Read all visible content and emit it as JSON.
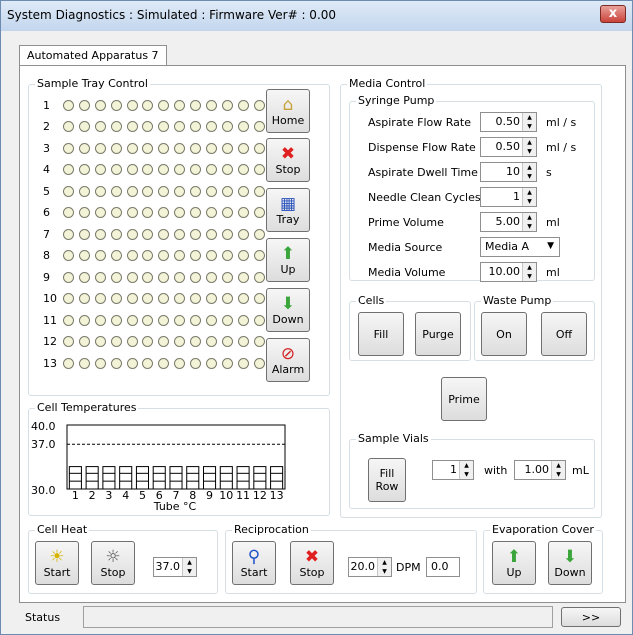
{
  "window": {
    "title": "System Diagnostics : Simulated : Firmware Ver# : 0.00",
    "close_label": "x"
  },
  "tab": {
    "label": "Automated Apparatus 7"
  },
  "tray": {
    "label": "Sample Tray Control",
    "rows": [
      "1",
      "2",
      "3",
      "4",
      "5",
      "6",
      "7",
      "8",
      "9",
      "10",
      "11",
      "12",
      "13"
    ],
    "buttons": {
      "home": "Home",
      "stop": "Stop",
      "tray": "Tray",
      "up": "Up",
      "down": "Down",
      "alarm": "Alarm"
    }
  },
  "media": {
    "label": "Media Control",
    "syringe_label": "Syringe Pump",
    "fields": [
      {
        "label": "Aspirate Flow Rate",
        "value": "0.50",
        "unit": "ml / s"
      },
      {
        "label": "Dispense Flow Rate",
        "value": "0.50",
        "unit": "ml / s"
      },
      {
        "label": "Aspirate Dwell Time",
        "value": "10",
        "unit": "s"
      },
      {
        "label": "Needle Clean Cycles",
        "value": "1",
        "unit": ""
      },
      {
        "label": "Prime Volume",
        "value": "5.00",
        "unit": "ml"
      },
      {
        "label": "Media Source",
        "value": "Media A",
        "unit": ""
      },
      {
        "label": "Media Volume",
        "value": "10.00",
        "unit": "ml"
      }
    ],
    "cells_label": "Cells",
    "fill": "Fill",
    "purge": "Purge",
    "waste_label": "Waste Pump",
    "on": "On",
    "off": "Off",
    "prime": "Prime",
    "vials_label": "Sample Vials",
    "fill_row_1": "Fill",
    "fill_row_2": "Row",
    "vial_count": "1",
    "with_label": "with",
    "vial_volume": "1.00",
    "vial_unit": "mL"
  },
  "temps": {
    "label": "Cell Temperatures",
    "y_ticks": [
      "40.0",
      "37.0",
      "30.0"
    ],
    "x_ticks": [
      "1",
      "2",
      "3",
      "4",
      "5",
      "6",
      "7",
      "8",
      "9",
      "10",
      "11",
      "12",
      "13"
    ],
    "xlabel": "Tube °C"
  },
  "chart_data": {
    "type": "bar",
    "categories": [
      "1",
      "2",
      "3",
      "4",
      "5",
      "6",
      "7",
      "8",
      "9",
      "10",
      "11",
      "12",
      "13"
    ],
    "values": [
      33.5,
      33.5,
      33.5,
      33.5,
      33.5,
      33.5,
      33.5,
      33.5,
      33.5,
      33.5,
      33.5,
      33.5,
      33.5
    ],
    "xlabel": "Tube °C",
    "ylim": [
      30.0,
      40.0
    ],
    "reference_line": 37.0
  },
  "heat": {
    "label": "Cell Heat",
    "start": "Start",
    "stop": "Stop",
    "setpoint": "37.0"
  },
  "recip": {
    "label": "Reciprocation",
    "start": "Start",
    "stop": "Stop",
    "dpm_value": "20.0",
    "dpm_label": "DPM",
    "dpm_readout": "0.0"
  },
  "evap": {
    "label": "Evaporation Cover",
    "up": "Up",
    "down": "Down"
  },
  "status": {
    "label": "Status",
    "expand": ">>"
  }
}
